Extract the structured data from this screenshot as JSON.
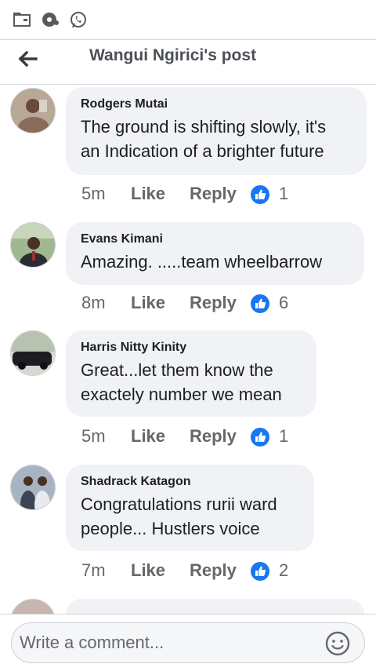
{
  "header": {
    "title": "Wangui Ngirici's post"
  },
  "comments": [
    {
      "author": "Rodgers Mutai",
      "lines": [
        "The ground is shifting slowly, it's",
        "an Indication of a brighter future"
      ],
      "time": "5m",
      "like": "Like",
      "reply": "Reply",
      "reactions": "1"
    },
    {
      "author": "Evans Kimani",
      "lines": [
        "Amazing. .....team wheelbarrow"
      ],
      "time": "8m",
      "like": "Like",
      "reply": "Reply",
      "reactions": "6"
    },
    {
      "author": "Harris Nitty Kinity",
      "lines": [
        "Great...let them know the",
        "exactely number we mean"
      ],
      "time": "5m",
      "like": "Like",
      "reply": "Reply",
      "reactions": "1"
    },
    {
      "author": "Shadrack Katagon",
      "lines": [
        "Congratulations rurii ward",
        "people... Hustlers voice"
      ],
      "time": "7m",
      "like": "Like",
      "reply": "Reply",
      "reactions": "2"
    }
  ],
  "composer": {
    "placeholder": "Write a comment..."
  },
  "colors": {
    "facebook_blue": "#1877f2",
    "bubble_bg": "#f0f2f5",
    "secondary_text": "#65676b"
  },
  "icons": [
    "folder-icon",
    "audio-icon",
    "whatsapp-icon",
    "back-arrow-icon",
    "like-reaction-icon",
    "emoji-icon"
  ]
}
